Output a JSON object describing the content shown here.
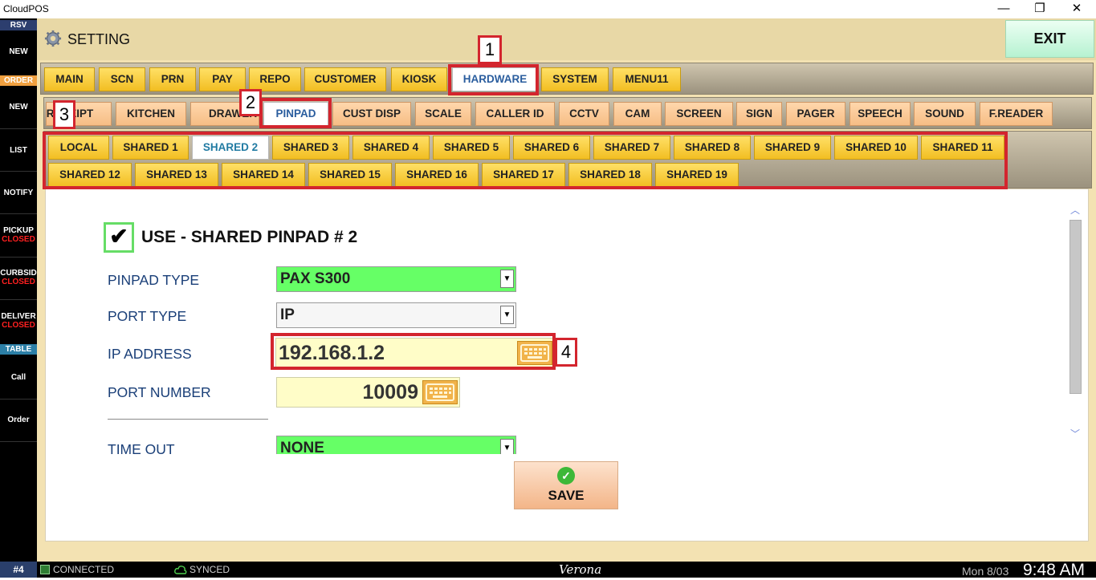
{
  "window": {
    "title": "CloudPOS",
    "minimize": "—",
    "restore": "❐",
    "close": "✕"
  },
  "sidebar": {
    "rsv": "RSV",
    "order_header": "ORDER",
    "table_header": "TABLE",
    "items": {
      "new_rsv": "NEW",
      "new_order": "NEW",
      "list": "LIST",
      "notify": "NOTIFY",
      "pickup": "PICKUP",
      "pickup_status": "CLOSED",
      "curbside": "CURBSID",
      "curbside_status": "CLOSED",
      "delivery": "DELIVER",
      "delivery_status": "CLOSED",
      "call": "Call",
      "order": "Order"
    },
    "colors": {
      "rsv_bg": "#2c3e6e",
      "order_bg": "#f0a040",
      "table_bg": "#2c7fa6",
      "closed": "#ff2020"
    }
  },
  "header": {
    "title": "SETTING",
    "exit_label": "EXIT",
    "icon": "gear-icon"
  },
  "main_tabs": [
    "MAIN",
    "SCN",
    "PRN",
    "PAY",
    "REPO",
    "CUSTOMER",
    "KIOSK",
    "HARDWARE",
    "SYSTEM",
    "MENU11"
  ],
  "sub_tabs": [
    "RECEIPT",
    "KITCHEN",
    "DRAWER",
    "PINPAD",
    "CUST DISP",
    "SCALE",
    "CALLER ID",
    "CCTV",
    "CAM",
    "SCREEN",
    "SIGN",
    "PAGER",
    "SPEECH",
    "SOUND",
    "F.READER"
  ],
  "shared_tabs": [
    "LOCAL",
    "SHARED 1",
    "SHARED 2",
    "SHARED 3",
    "SHARED 4",
    "SHARED 5",
    "SHARED 6",
    "SHARED 7",
    "SHARED 8",
    "SHARED 9",
    "SHARED 10",
    "SHARED 11",
    "SHARED 12",
    "SHARED 13",
    "SHARED 14",
    "SHARED 15",
    "SHARED 16",
    "SHARED 17",
    "SHARED 18",
    "SHARED 19"
  ],
  "active": {
    "main_tab": "HARDWARE",
    "sub_tab": "PINPAD",
    "shared_tab": "SHARED 2"
  },
  "annotations": [
    "1",
    "2",
    "3",
    "4"
  ],
  "form": {
    "use_checked": true,
    "use_label": "USE - SHARED PINPAD # 2",
    "checkmark": "✔",
    "pinpad_type": {
      "label": "PINPAD TYPE",
      "value": "PAX S300",
      "bg": "#66ff66"
    },
    "port_type": {
      "label": "PORT TYPE",
      "value": "IP",
      "bg": "#f6f6f6"
    },
    "ip_address": {
      "label": "IP ADDRESS",
      "value": "192.168.1.2"
    },
    "port_number": {
      "label": "PORT NUMBER",
      "value": "10009"
    },
    "time_out": {
      "label": "TIME OUT",
      "value": "NONE",
      "bg": "#66ff66"
    },
    "save_label": "SAVE",
    "keyboard_icon": "keyboard-icon"
  },
  "status_bar": {
    "terminal": "#4",
    "connection": "CONNECTED",
    "sync": "SYNCED",
    "location": "Verona",
    "date": "Mon 8/03",
    "time": "9:48 AM"
  }
}
